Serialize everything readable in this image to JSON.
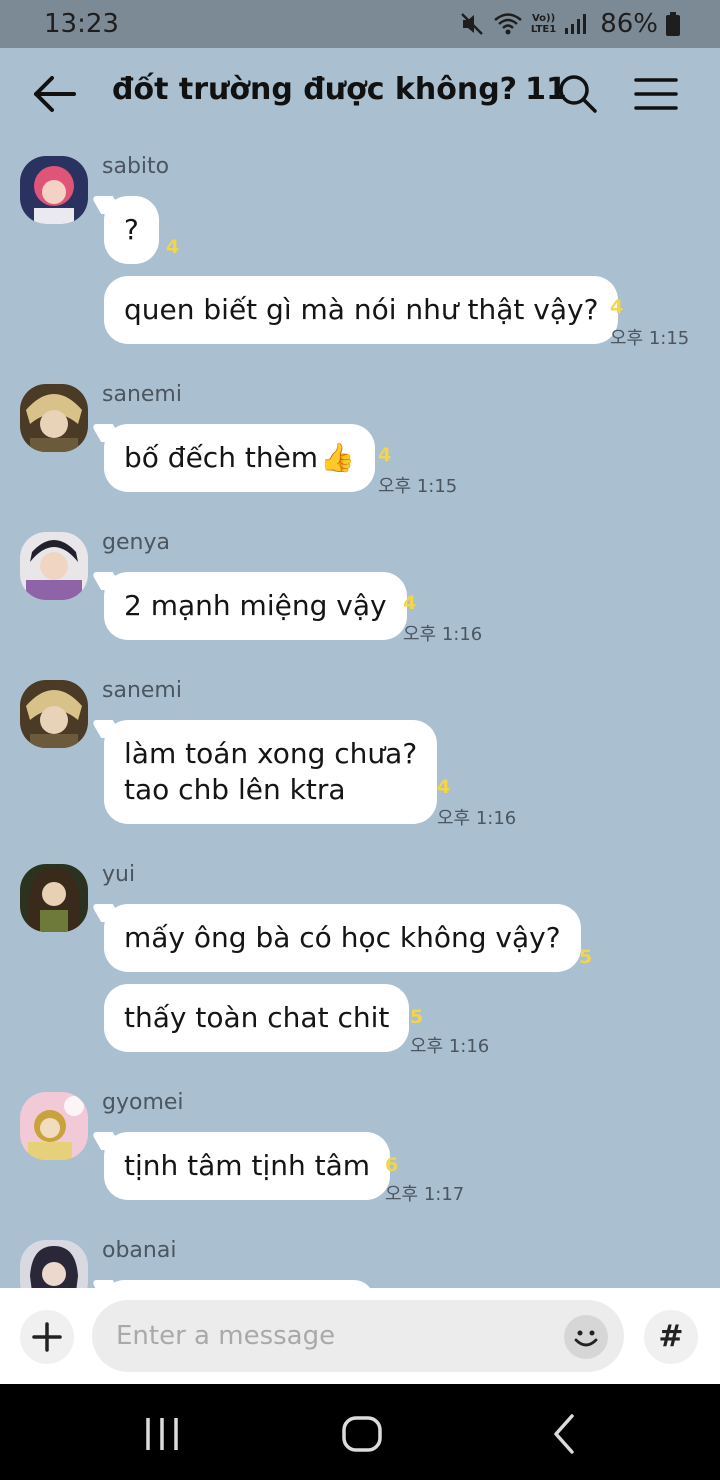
{
  "status_bar": {
    "time": "13:23",
    "lte_label": "LTE1",
    "battery": "86%",
    "icons": [
      "mute-icon",
      "wifi-icon",
      "volte-icon",
      "signal-icon",
      "battery-icon"
    ]
  },
  "header": {
    "title": "đốt trường được không?",
    "member_count": "11",
    "icons": [
      "back-arrow-icon",
      "search-icon",
      "menu-icon"
    ]
  },
  "messages": [
    {
      "sender": "sabito",
      "avatar_colors": [
        "#2a3360",
        "#e0547a"
      ],
      "bubbles": [
        {
          "text": "?",
          "unread": "4"
        },
        {
          "text": "quen biết gì mà nói như thật vậy?",
          "unread": "4",
          "time": "오후 1:15"
        }
      ]
    },
    {
      "sender": "sanemi",
      "avatar_colors": [
        "#4a3a26",
        "#d8c28a"
      ],
      "bubbles": [
        {
          "text": "bố đếch thèm",
          "emoji": "👍",
          "unread": "4",
          "time": "오후 1:15"
        }
      ]
    },
    {
      "sender": "genya",
      "avatar_colors": [
        "#3a2d3e",
        "#8e63a8"
      ],
      "bubbles": [
        {
          "text": "2 mạnh miệng vậy",
          "unread": "4",
          "time": "오후 1:16"
        }
      ]
    },
    {
      "sender": "sanemi",
      "avatar_colors": [
        "#4a3a26",
        "#d8c28a"
      ],
      "bubbles": [
        {
          "lines": [
            "làm toán xong chưa?",
            "tao chb lên ktra"
          ],
          "unread": "4",
          "time": "오후 1:16"
        }
      ]
    },
    {
      "sender": "yui",
      "avatar_colors": [
        "#2b3320",
        "#6e7a3a"
      ],
      "bubbles": [
        {
          "text": "mấy ông bà có học không vậy?",
          "unread": "5"
        },
        {
          "text": "thấy toàn chat chit",
          "unread": "5",
          "time": "오후 1:16"
        }
      ]
    },
    {
      "sender": "gyomei",
      "avatar_colors": [
        "#f2c9d7",
        "#c8a23a"
      ],
      "bubbles": [
        {
          "text": "tịnh tâm tịnh tâm",
          "unread": "6",
          "time": "오후 1:17"
        }
      ]
    },
    {
      "sender": "obanai",
      "avatar_colors": [
        "#d9d9e2",
        "#3b3550"
      ],
      "bubbles": []
    }
  ],
  "input_bar": {
    "placeholder": "Enter a message",
    "hash_label": "#",
    "icons": [
      "plus-icon",
      "emoji-icon",
      "hashtag-icon"
    ]
  },
  "nav_bar": {
    "icons": [
      "recent-apps-icon",
      "home-icon",
      "nav-back-icon"
    ]
  }
}
